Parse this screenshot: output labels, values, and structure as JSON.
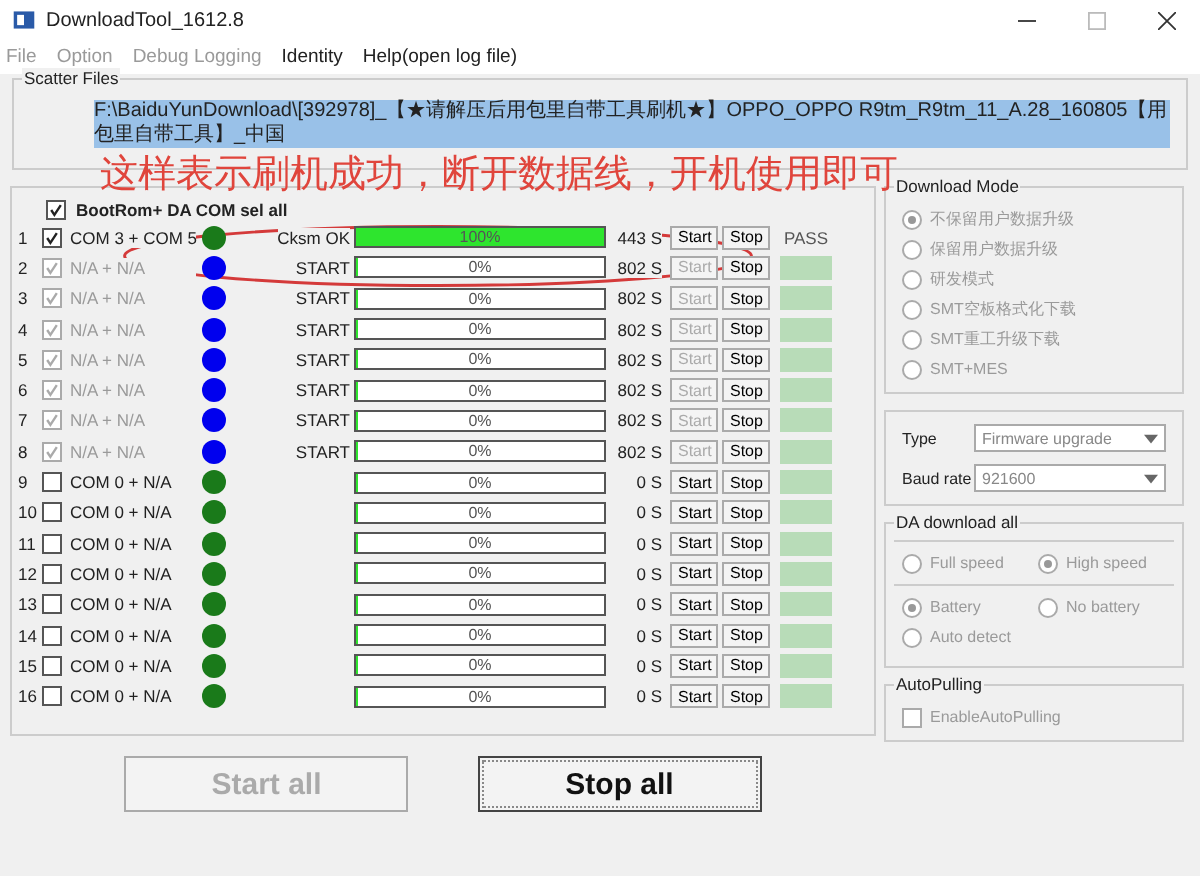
{
  "window": {
    "title": "DownloadTool_1612.8"
  },
  "menu": [
    {
      "label": "File",
      "disabled": true
    },
    {
      "label": "Option",
      "disabled": true
    },
    {
      "label": "Debug Logging",
      "disabled": true
    },
    {
      "label": "Identity",
      "disabled": false
    },
    {
      "label": "Help(open log file)",
      "disabled": false
    }
  ],
  "scatter_files": {
    "label": "Scatter Files",
    "path": "F:\\BaiduYunDownload\\[392978]_【★请解压后用包里自带工具刷机★】OPPO_OPPO R9tm_R9tm_11_A.28_160805【用包里自带工具】_中国"
  },
  "annotation": {
    "text": "这样表示刷机成功，断开数据线，开机使用即可"
  },
  "select_all": {
    "label": "BootRom+ DA COM sel all",
    "checked": true
  },
  "ports": [
    {
      "index": "1",
      "checked": true,
      "disabled": false,
      "port": "COM 3 + COM 5",
      "color": "#1a7a1a",
      "status": "Cksm OK",
      "level": 1,
      "percent": "100%",
      "time": "443 S",
      "start_disabled": false,
      "start": "Start",
      "stop": "Stop",
      "result": "PASS"
    },
    {
      "index": "2",
      "checked": true,
      "disabled": true,
      "port": "N/A + N/A",
      "color": "#0000ee",
      "status": "START",
      "level": 0,
      "percent": "0%",
      "time": "802 S",
      "start_disabled": true,
      "start": "Start",
      "stop": "Stop"
    },
    {
      "index": "3",
      "checked": true,
      "disabled": true,
      "port": "N/A + N/A",
      "color": "#0000ee",
      "status": "START",
      "level": 0,
      "percent": "0%",
      "time": "802 S",
      "start_disabled": true,
      "start": "Start",
      "stop": "Stop"
    },
    {
      "index": "4",
      "checked": true,
      "disabled": true,
      "port": "N/A + N/A",
      "color": "#0000ee",
      "status": "START",
      "level": 0,
      "percent": "0%",
      "time": "802 S",
      "start_disabled": true,
      "start": "Start",
      "stop": "Stop"
    },
    {
      "index": "5",
      "checked": true,
      "disabled": true,
      "port": "N/A + N/A",
      "color": "#0000ee",
      "status": "START",
      "level": 0,
      "percent": "0%",
      "time": "802 S",
      "start_disabled": true,
      "start": "Start",
      "stop": "Stop"
    },
    {
      "index": "6",
      "checked": true,
      "disabled": true,
      "port": "N/A + N/A",
      "color": "#0000ee",
      "status": "START",
      "level": 0,
      "percent": "0%",
      "time": "802 S",
      "start_disabled": true,
      "start": "Start",
      "stop": "Stop"
    },
    {
      "index": "7",
      "checked": true,
      "disabled": true,
      "port": "N/A + N/A",
      "color": "#0000ee",
      "status": "START",
      "level": 0,
      "percent": "0%",
      "time": "802 S",
      "start_disabled": true,
      "start": "Start",
      "stop": "Stop"
    },
    {
      "index": "8",
      "checked": true,
      "disabled": true,
      "port": "N/A + N/A",
      "color": "#0000ee",
      "status": "START",
      "level": 0,
      "percent": "0%",
      "time": "802 S",
      "start_disabled": true,
      "start": "Start",
      "stop": "Stop"
    },
    {
      "index": "9",
      "checked": false,
      "disabled": false,
      "port": "COM 0 + N/A",
      "color": "#1a7a1a",
      "level": 0,
      "percent": "0%",
      "time": "0 S",
      "start_disabled": false,
      "start": "Start",
      "stop": "Stop"
    },
    {
      "index": "10",
      "checked": false,
      "disabled": false,
      "port": "COM 0 + N/A",
      "color": "#1a7a1a",
      "level": 0,
      "percent": "0%",
      "time": "0 S",
      "start_disabled": false,
      "start": "Start",
      "stop": "Stop"
    },
    {
      "index": "11",
      "checked": false,
      "disabled": false,
      "port": "COM 0 + N/A",
      "color": "#1a7a1a",
      "level": 0,
      "percent": "0%",
      "time": "0 S",
      "start_disabled": false,
      "start": "Start",
      "stop": "Stop"
    },
    {
      "index": "12",
      "checked": false,
      "disabled": false,
      "port": "COM 0 + N/A",
      "color": "#1a7a1a",
      "level": 0,
      "percent": "0%",
      "time": "0 S",
      "start_disabled": false,
      "start": "Start",
      "stop": "Stop"
    },
    {
      "index": "13",
      "checked": false,
      "disabled": false,
      "port": "COM 0 + N/A",
      "color": "#1a7a1a",
      "level": 0,
      "percent": "0%",
      "time": "0 S",
      "start_disabled": false,
      "start": "Start",
      "stop": "Stop"
    },
    {
      "index": "14",
      "checked": false,
      "disabled": false,
      "port": "COM 0 + N/A",
      "color": "#1a7a1a",
      "level": 0,
      "percent": "0%",
      "time": "0 S",
      "start_disabled": false,
      "start": "Start",
      "stop": "Stop"
    },
    {
      "index": "15",
      "checked": false,
      "disabled": false,
      "port": "COM 0 + N/A",
      "color": "#1a7a1a",
      "level": 0,
      "percent": "0%",
      "time": "0 S",
      "start_disabled": false,
      "start": "Start",
      "stop": "Stop"
    },
    {
      "index": "16",
      "checked": false,
      "disabled": false,
      "port": "COM 0 + N/A",
      "color": "#1a7a1a",
      "level": 0,
      "percent": "0%",
      "time": "0 S",
      "start_disabled": false,
      "start": "Start",
      "stop": "Stop"
    }
  ],
  "download_mode": {
    "label": "Download Mode",
    "options": [
      {
        "label": "不保留用户数据升级",
        "selected": true
      },
      {
        "label": "保留用户数据升级",
        "selected": false
      },
      {
        "label": "研发模式",
        "selected": false
      },
      {
        "label": "SMT空板格式化下载",
        "selected": false
      },
      {
        "label": "SMT重工升级下载",
        "selected": false
      },
      {
        "label": "SMT+MES",
        "selected": false
      }
    ]
  },
  "settings": [
    {
      "label": "Type",
      "value": "Firmware upgrade"
    },
    {
      "label": "Baud rate",
      "value": "921600"
    }
  ],
  "da_download": {
    "label": "DA download all",
    "speed": [
      {
        "label": "Full speed",
        "selected": false
      },
      {
        "label": "High speed",
        "selected": true
      }
    ],
    "battery": [
      {
        "label": "Battery",
        "selected": true
      },
      {
        "label": "No battery",
        "selected": false
      },
      {
        "label": "Auto detect",
        "selected": false
      }
    ]
  },
  "auto_pulling": {
    "label": "AutoPulling",
    "option": "EnableAutoPulling",
    "checked": false
  },
  "buttons": [
    {
      "label": "Start all",
      "disabled": true
    },
    {
      "label": "Stop all",
      "disabled": false
    }
  ]
}
